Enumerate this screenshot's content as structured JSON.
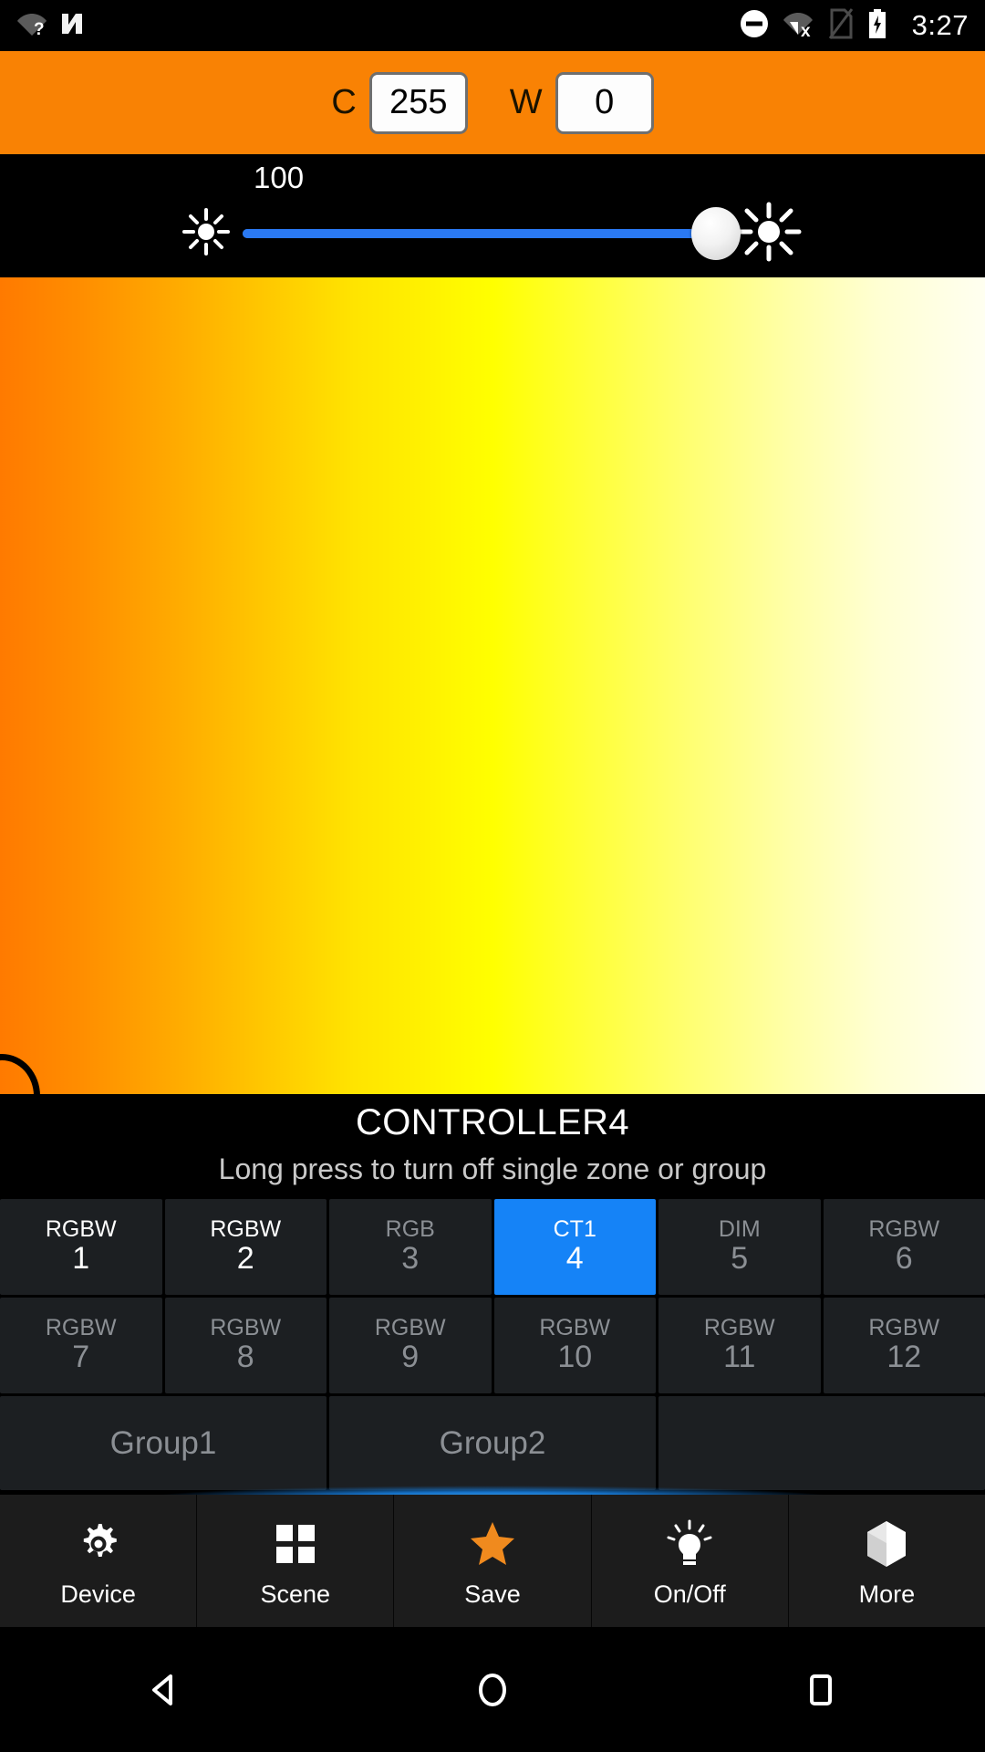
{
  "statusbar": {
    "clock": "3:27",
    "icons_left": [
      "wifi-question-icon",
      "android-n-logo-icon"
    ],
    "icons_right": [
      "do-not-disturb-icon",
      "wifi-disconnected-icon",
      "sim-off-icon",
      "battery-charging-icon"
    ]
  },
  "cwbar": {
    "accent_color": "#f98204",
    "cool_label": "C",
    "cool_value": "255",
    "warm_label": "W",
    "warm_value": "0"
  },
  "brightness": {
    "value": "100",
    "min_icon": "brightness-low-icon",
    "max_icon": "brightness-high-icon",
    "percent": 100,
    "track_color": "#2a79f3"
  },
  "controller": {
    "name": "CONTROLLER4",
    "hint": "Long press to turn off single zone or group"
  },
  "zones": [
    {
      "type": "RGBW",
      "number": "1",
      "state": "on",
      "selected": false
    },
    {
      "type": "RGBW",
      "number": "2",
      "state": "on",
      "selected": false
    },
    {
      "type": "RGB",
      "number": "3",
      "state": "off",
      "selected": false
    },
    {
      "type": "CT1",
      "number": "4",
      "state": "on",
      "selected": true
    },
    {
      "type": "DIM",
      "number": "5",
      "state": "off",
      "selected": false
    },
    {
      "type": "RGBW",
      "number": "6",
      "state": "off",
      "selected": false
    },
    {
      "type": "RGBW",
      "number": "7",
      "state": "off",
      "selected": false
    },
    {
      "type": "RGBW",
      "number": "8",
      "state": "off",
      "selected": false
    },
    {
      "type": "RGBW",
      "number": "9",
      "state": "off",
      "selected": false
    },
    {
      "type": "RGBW",
      "number": "10",
      "state": "off",
      "selected": false
    },
    {
      "type": "RGBW",
      "number": "11",
      "state": "off",
      "selected": false
    },
    {
      "type": "RGBW",
      "number": "12",
      "state": "off",
      "selected": false
    }
  ],
  "groups": [
    {
      "label": "Group1"
    },
    {
      "label": "Group2"
    },
    {
      "label": ""
    }
  ],
  "toolbar": [
    {
      "label": "Device",
      "icon": "gear-icon",
      "color": "#ffffff"
    },
    {
      "label": "Scene",
      "icon": "grid-icon",
      "color": "#ffffff"
    },
    {
      "label": "Save",
      "icon": "star-icon",
      "color": "#f08a1e"
    },
    {
      "label": "On/Off",
      "icon": "lightbulb-icon",
      "color": "#ffffff"
    },
    {
      "label": "More",
      "icon": "cube-icon",
      "color": "#ffffff"
    }
  ],
  "navbar": {
    "back": "back-triangle-icon",
    "home": "home-circle-icon",
    "recents": "recents-square-icon"
  },
  "gradient": {
    "from": "#ff7a00",
    "mid": "#ffff00",
    "to": "#fffff0"
  }
}
